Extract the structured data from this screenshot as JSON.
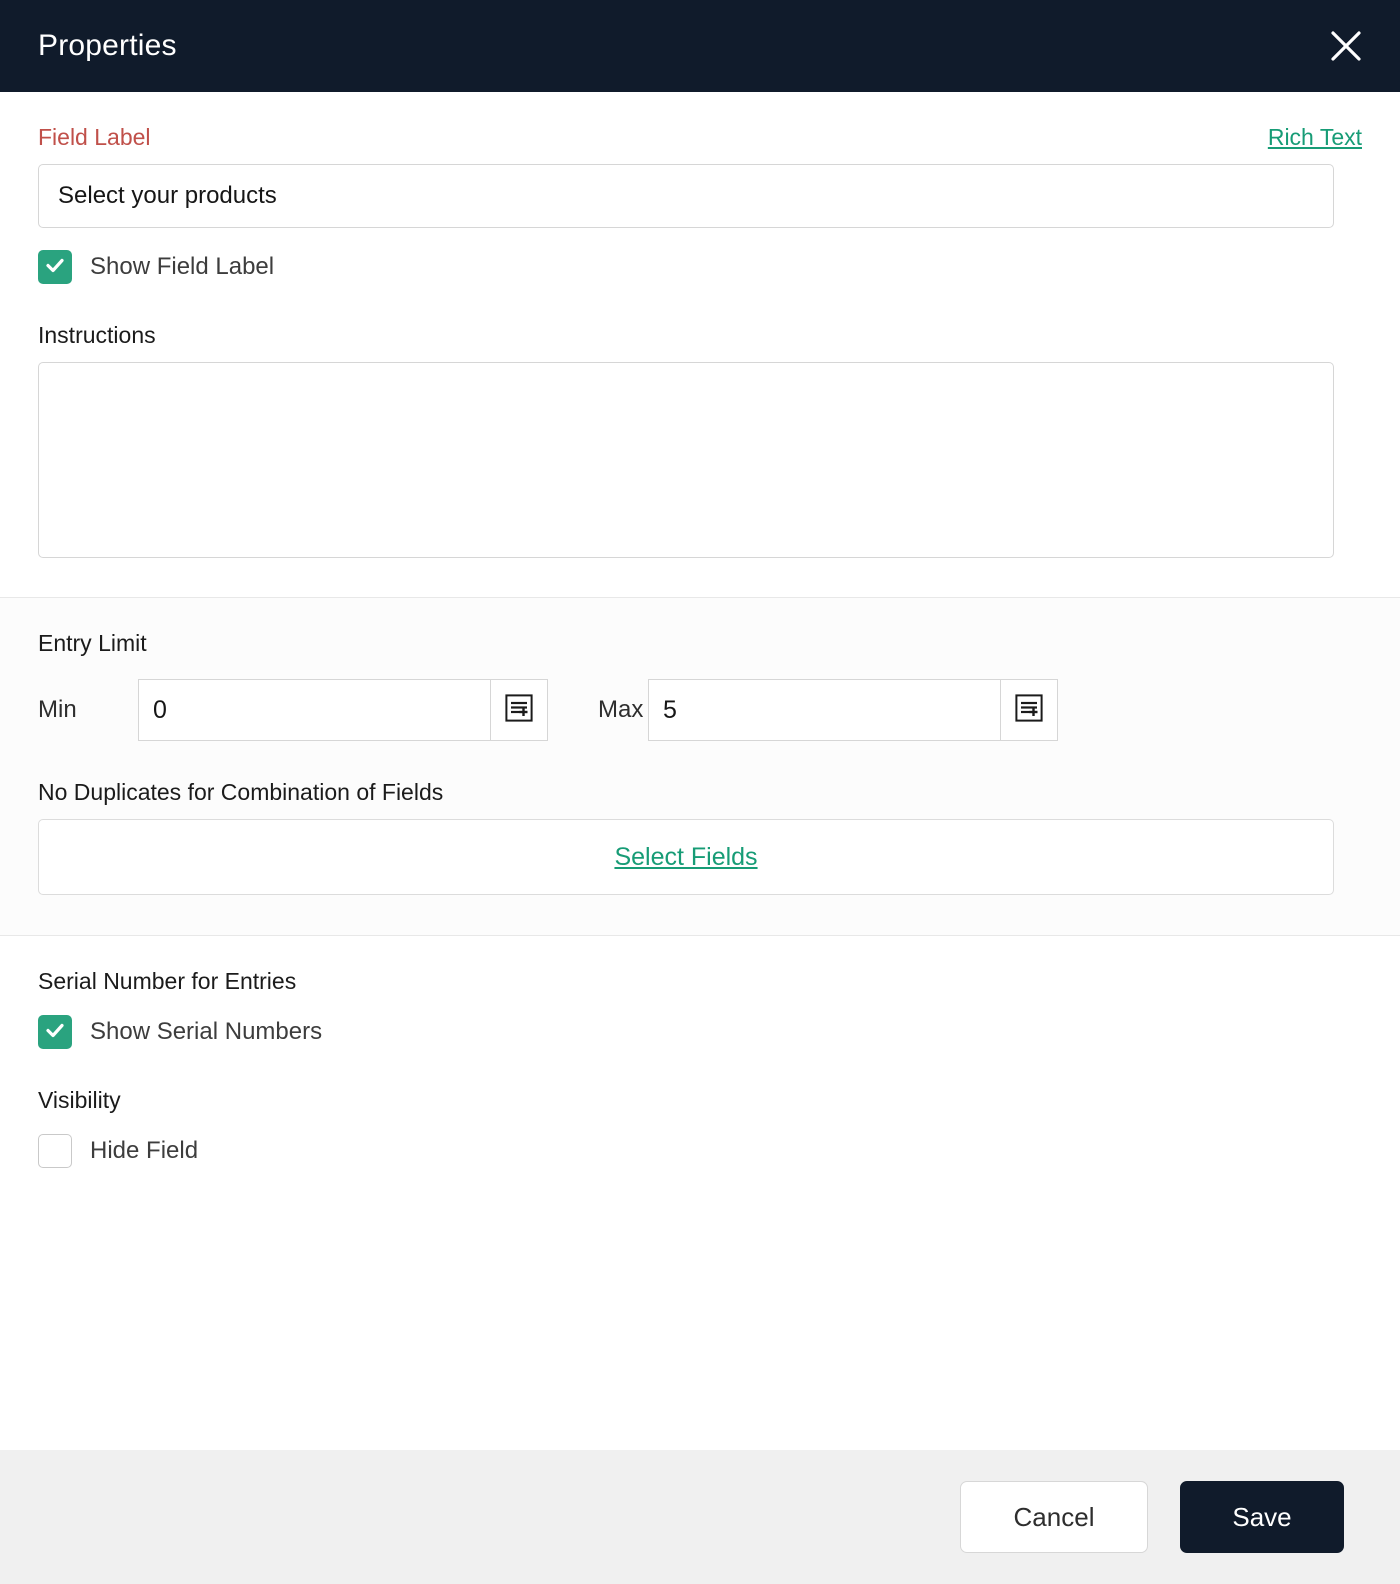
{
  "header": {
    "title": "Properties",
    "close_icon": "close-icon"
  },
  "field_label_section": {
    "label": "Field Label",
    "rich_text_link": "Rich Text",
    "input_value": "Select your products",
    "input_placeholder": "",
    "show_field_label": {
      "label": "Show Field Label",
      "checked": true
    }
  },
  "instructions_section": {
    "label": "Instructions",
    "value": "",
    "placeholder": ""
  },
  "entry_limit_section": {
    "title": "Entry Limit",
    "min": {
      "label": "Min",
      "value": "0",
      "stepper_icon": "insert-field-icon"
    },
    "max": {
      "label": "Max",
      "value": "5",
      "stepper_icon": "insert-field-icon"
    },
    "no_duplicates": {
      "title": "No Duplicates for Combination of Fields",
      "select_fields_link": "Select Fields"
    }
  },
  "serial_number_section": {
    "title": "Serial Number for Entries",
    "show_serial_numbers": {
      "label": "Show Serial Numbers",
      "checked": true
    }
  },
  "visibility_section": {
    "title": "Visibility",
    "hide_field": {
      "label": "Hide Field",
      "checked": false
    }
  },
  "footer": {
    "cancel_label": "Cancel",
    "save_label": "Save"
  },
  "colors": {
    "header_bg": "#101b2b",
    "accent_green": "#179c76",
    "checkbox_green": "#2aa37f",
    "required_red": "#c0504a",
    "footer_bg": "#f0f0f0",
    "save_btn_bg": "#101b2b"
  }
}
